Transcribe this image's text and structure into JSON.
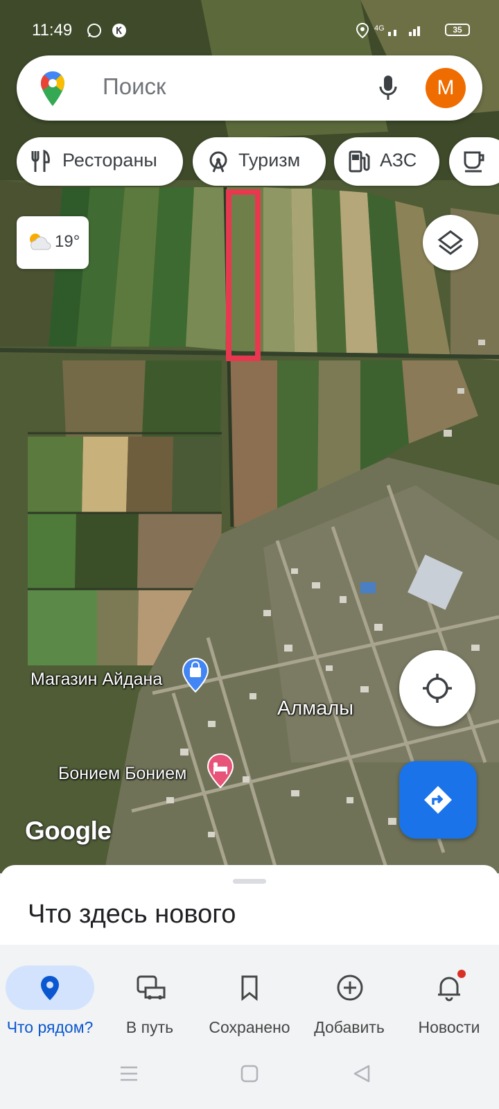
{
  "status_bar": {
    "time": "11:49",
    "battery": "35"
  },
  "search": {
    "placeholder": "Поиск",
    "avatar_letter": "M"
  },
  "chips": [
    {
      "label": "Рестораны",
      "icon": "restaurant-icon"
    },
    {
      "label": "Туризм",
      "icon": "tourism-icon"
    },
    {
      "label": "АЗС",
      "icon": "gas-station-icon"
    },
    {
      "label": "",
      "icon": "cafe-icon"
    }
  ],
  "weather": {
    "temperature": "19°",
    "icon": "partly-cloudy-icon"
  },
  "map": {
    "places": [
      {
        "name": "Магазин Айдана",
        "icon": "shopping-bag-icon",
        "color": "#4285f4"
      },
      {
        "name": "Алмалы"
      },
      {
        "name": "Бонием Бонием",
        "icon": "hotel-bed-icon",
        "color": "#e8537a"
      }
    ],
    "attribution": "Google",
    "highlight_color": "#e8384f"
  },
  "sheet": {
    "title": "Что здесь нового"
  },
  "bottom_nav": [
    {
      "label": "Что рядом?",
      "icon": "explore-pin-icon",
      "active": true
    },
    {
      "label": "В путь",
      "icon": "commute-icon",
      "active": false
    },
    {
      "label": "Сохранено",
      "icon": "bookmark-icon",
      "active": false
    },
    {
      "label": "Добавить",
      "icon": "add-circle-icon",
      "active": false
    },
    {
      "label": "Новости",
      "icon": "bell-icon",
      "active": false
    }
  ],
  "colors": {
    "accent": "#1a73e8",
    "avatar": "#ef6c00"
  }
}
